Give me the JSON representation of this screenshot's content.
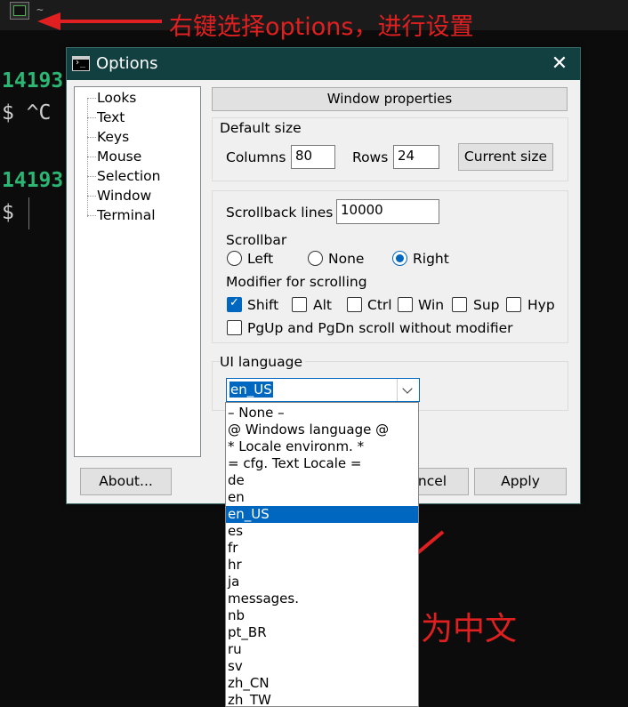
{
  "terminal": {
    "tilde": "~",
    "pid_1": "14193",
    "prompt_1": "$ ^C",
    "pid_2": "14193",
    "prompt_2": "$"
  },
  "annotations": {
    "top_note": "右键选择options，进行设置",
    "bottom_note": "即为中文",
    "color": "#e02020"
  },
  "dialog": {
    "title": "Options",
    "close_icon": "close-icon",
    "tree": [
      "Looks",
      "Text",
      "Keys",
      "Mouse",
      "Selection",
      "Window",
      "Terminal"
    ],
    "header": "Window properties",
    "default_size": {
      "legend": "Default size",
      "columns_label": "Columns",
      "columns_value": "80",
      "rows_label": "Rows",
      "rows_value": "24",
      "current_size_button": "Current size"
    },
    "scroll": {
      "scrollback_label": "Scrollback lines",
      "scrollback_value": "10000",
      "scrollbar_label": "Scrollbar",
      "scrollbar_options": [
        "Left",
        "None",
        "Right"
      ],
      "scrollbar_selected": "Right",
      "modifier_label": "Modifier for scrolling",
      "modifiers": [
        {
          "label": "Shift",
          "checked": true
        },
        {
          "label": "Alt",
          "checked": false
        },
        {
          "label": "Ctrl",
          "checked": false
        },
        {
          "label": "Win",
          "checked": false
        },
        {
          "label": "Sup",
          "checked": false
        },
        {
          "label": "Hyp",
          "checked": false
        }
      ],
      "pgup_label": "PgUp and PgDn scroll without modifier",
      "pgup_checked": false
    },
    "ui_language": {
      "legend": "UI language",
      "selected": "en_US",
      "options": [
        "– None –",
        "@ Windows language @",
        "* Locale environm. *",
        "= cfg. Text Locale =",
        "de",
        "en",
        "en_US",
        "es",
        "fr",
        "hr",
        "ja",
        "messages.",
        "nb",
        "pt_BR",
        "ru",
        "sv",
        "zh_CN",
        "zh_TW"
      ]
    },
    "buttons": {
      "about": "About...",
      "cancel_partial": "ncel",
      "apply": "Apply"
    },
    "accent": "#0067c0",
    "titlebar_color": "#123f3f"
  }
}
